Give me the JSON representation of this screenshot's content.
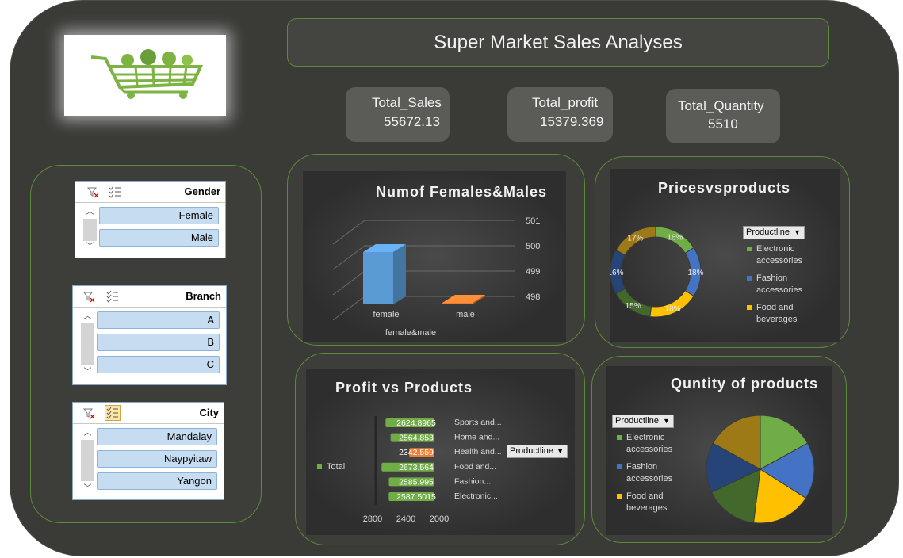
{
  "dashboard": {
    "title": "Super Market Sales Analyses"
  },
  "kpis": {
    "total_sales": {
      "label": "Total_Sales",
      "value": "55672.13"
    },
    "total_profit": {
      "label": "Total_profit",
      "value": "15379.369"
    },
    "total_quantity": {
      "label": "Total_Quantity",
      "value": "5510"
    }
  },
  "slicers": {
    "gender": {
      "title": "Gender",
      "items": [
        "Female",
        "Male"
      ]
    },
    "branch": {
      "title": "Branch",
      "items": [
        "A",
        "B",
        "C"
      ]
    },
    "city": {
      "title": "City",
      "items": [
        "Mandalay",
        "Naypyitaw",
        "Yangon"
      ]
    }
  },
  "colors": {
    "green": "#70ad47",
    "blue": "#4472c4",
    "gold": "#ffc000",
    "darkgreen": "#43682b",
    "navy": "#264478",
    "olive": "#9e7a16",
    "orange": "#ed7d31",
    "barblue": "#5b9bd5"
  },
  "filter_button": "Productline",
  "chart_data": [
    {
      "type": "bar",
      "title": "Numof Females&Males",
      "categories": [
        "female",
        "male"
      ],
      "values": [
        500.5,
        498.5
      ],
      "xlabel": "female&male",
      "ylim": [
        498,
        501
      ],
      "yticks": [
        "498",
        "499",
        "500",
        "501"
      ],
      "legend": "none"
    },
    {
      "type": "pie",
      "variant": "doughnut",
      "title": "Pricesvsproducts",
      "legend_title": "Productline",
      "legend_entries": [
        "Electronic accessories",
        "Fashion accessories",
        "Food and beverages"
      ],
      "legend_entries_lines": [
        [
          "Electronic",
          "accessories"
        ],
        [
          "Fashion",
          "accessories"
        ],
        [
          "Food and",
          "beverages"
        ]
      ],
      "slice_labels": [
        "16%",
        "18%",
        "18%",
        "15%",
        "16%",
        "17%"
      ],
      "values": [
        16,
        18,
        18,
        15,
        16,
        17
      ],
      "legend_placement": "right"
    },
    {
      "type": "bar",
      "orientation": "horizontal",
      "title": "Profit vs Products",
      "categories": [
        "Electronic...",
        "Fashion...",
        "Food and...",
        "Health and...",
        "Home and...",
        "Sports and..."
      ],
      "values": [
        2587.5015,
        2585.995,
        2673.564,
        2342.559,
        2564.853,
        2624.8965
      ],
      "value_labels": [
        "2587.5015",
        "2585.995",
        "2673.564",
        "2342.559",
        "2564.853",
        "2624.8965"
      ],
      "series": [
        {
          "name": "Total"
        }
      ],
      "xticks": [
        "2800",
        "2400",
        "2000"
      ],
      "xlim": [
        2000,
        2800
      ],
      "reversed_axis": true,
      "legend_placement": "left"
    },
    {
      "type": "pie",
      "title": "Quntity of products",
      "legend_title": "Productline",
      "legend_entries": [
        "Electronic accessories",
        "Fashion accessories",
        "Food and beverages"
      ],
      "legend_entries_lines": [
        [
          "Electronic",
          "accessories"
        ],
        [
          "Fashion",
          "accessories"
        ],
        [
          "Food and",
          "beverages"
        ]
      ],
      "values": [
        17,
        17,
        18,
        16,
        15,
        17
      ],
      "legend_placement": "left"
    }
  ]
}
